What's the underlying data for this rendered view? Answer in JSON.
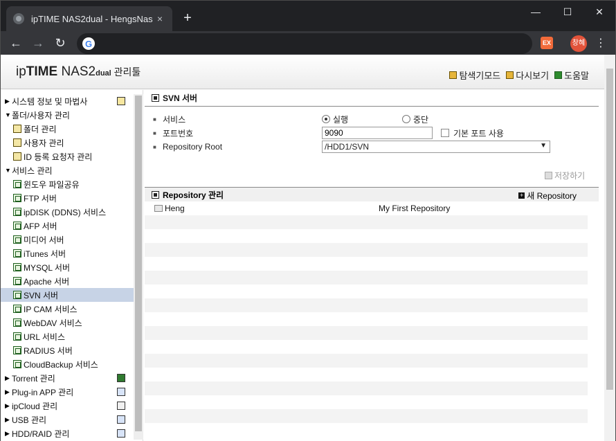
{
  "browser": {
    "tab_title": "ipTIME NAS2dual - HengsNas",
    "tab_close": "×",
    "new_tab": "+",
    "window": {
      "minimize": "—",
      "maximize": "☐",
      "close": "✕"
    },
    "nav": {
      "back": "←",
      "forward": "→",
      "reload": "↻"
    },
    "omnibox_value": "",
    "google_glyph": "G",
    "extension_label": "EX",
    "profile_label": "창혜",
    "menu": "⋮"
  },
  "header": {
    "logo_ip": "ip",
    "logo_time": "TIME",
    "logo_nas": " NAS2",
    "logo_dual": "dual",
    "logo_kor": " 관리툴",
    "links": [
      {
        "label": "탐색기모드"
      },
      {
        "label": "다시보기"
      },
      {
        "label": "도움말"
      }
    ]
  },
  "sidebar": {
    "items": [
      {
        "label": "시스템 정보 및 마법사",
        "expanded": false
      },
      {
        "label": "폴더/사용자 관리",
        "expanded": true
      },
      {
        "label": "폴더 관리"
      },
      {
        "label": "사용자 관리"
      },
      {
        "label": "ID 등록 요청자 관리"
      },
      {
        "label": "서비스 관리",
        "expanded": true
      },
      {
        "label": "윈도우 파일공유"
      },
      {
        "label": "FTP 서버"
      },
      {
        "label": "ipDISK (DDNS) 서비스"
      },
      {
        "label": "AFP 서버"
      },
      {
        "label": "미디어 서버"
      },
      {
        "label": "iTunes 서버"
      },
      {
        "label": "MYSQL 서버"
      },
      {
        "label": "Apache 서버"
      },
      {
        "label": "SVN 서버",
        "selected": true
      },
      {
        "label": "IP CAM 서비스"
      },
      {
        "label": "WebDAV 서비스"
      },
      {
        "label": "URL 서비스"
      },
      {
        "label": "RADIUS 서버"
      },
      {
        "label": "CloudBackup 서비스"
      },
      {
        "label": "Torrent 관리",
        "expanded": false
      },
      {
        "label": "Plug-in APP 관리",
        "expanded": false
      },
      {
        "label": "ipCloud 관리",
        "expanded": false
      },
      {
        "label": "USB 관리",
        "expanded": false
      },
      {
        "label": "HDD/RAID 관리",
        "expanded": false
      }
    ]
  },
  "main": {
    "section_title": "SVN 서버",
    "service_label": "서비스",
    "run_label": "실행",
    "stop_label": "중단",
    "service_state": "run",
    "port_label": "포트번호",
    "port_value": "9090",
    "default_port_label": "기본 포트 사용",
    "repo_root_label": "Repository Root",
    "repo_root_value": "/HDD1/SVN",
    "save_label": "저장하기",
    "repo_section_title": "Repository 관리",
    "new_repo_label": "새 Repository",
    "repos": [
      {
        "name": "Heng",
        "description": "My First Repository"
      }
    ]
  }
}
